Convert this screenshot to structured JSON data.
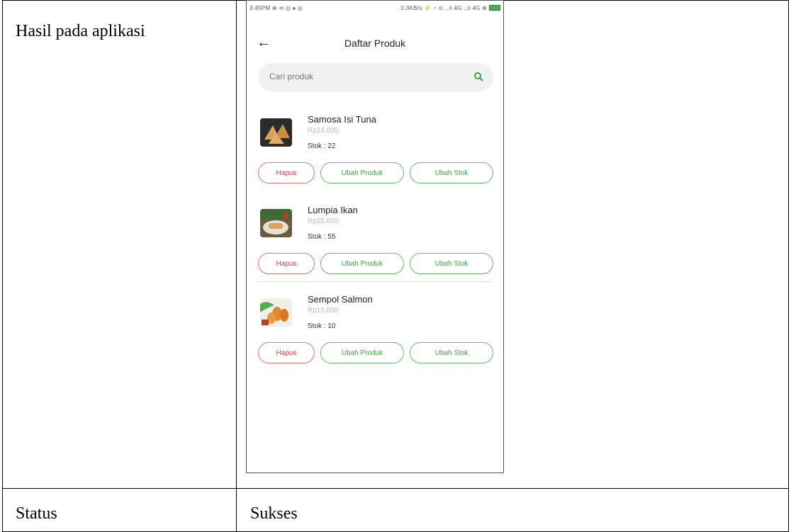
{
  "document": {
    "row1_label": "Hasil pada aplikasi",
    "row2_label": "Status",
    "row2_value": "Sukses"
  },
  "phone": {
    "status_left": "3:45PM ⊕ ⊲ ◎ ♠ ◎",
    "status_right": "0.3KB/s ⚡ ◔ ⊙ ..ıl 4G ..ıl 4G ⊗",
    "title": "Daftar Produk",
    "search_placeholder": "Cari produk",
    "products": [
      {
        "name": "Samosa Isi Tuna",
        "price": "Rp24.000",
        "stock": "Stok : 22"
      },
      {
        "name": "Lumpia Ikan",
        "price": "Rp25.000",
        "stock": "Stok : 55"
      },
      {
        "name": "Sempol Salmon",
        "price": "Rp15.000",
        "stock": "Stok : 10"
      }
    ],
    "buttons": {
      "delete": "Hapus",
      "edit": "Ubah Produk",
      "stock": "Ubah Stok"
    }
  },
  "colors": {
    "danger": "#e53935",
    "success": "#43a047",
    "search_bg": "#f1f1f1"
  }
}
